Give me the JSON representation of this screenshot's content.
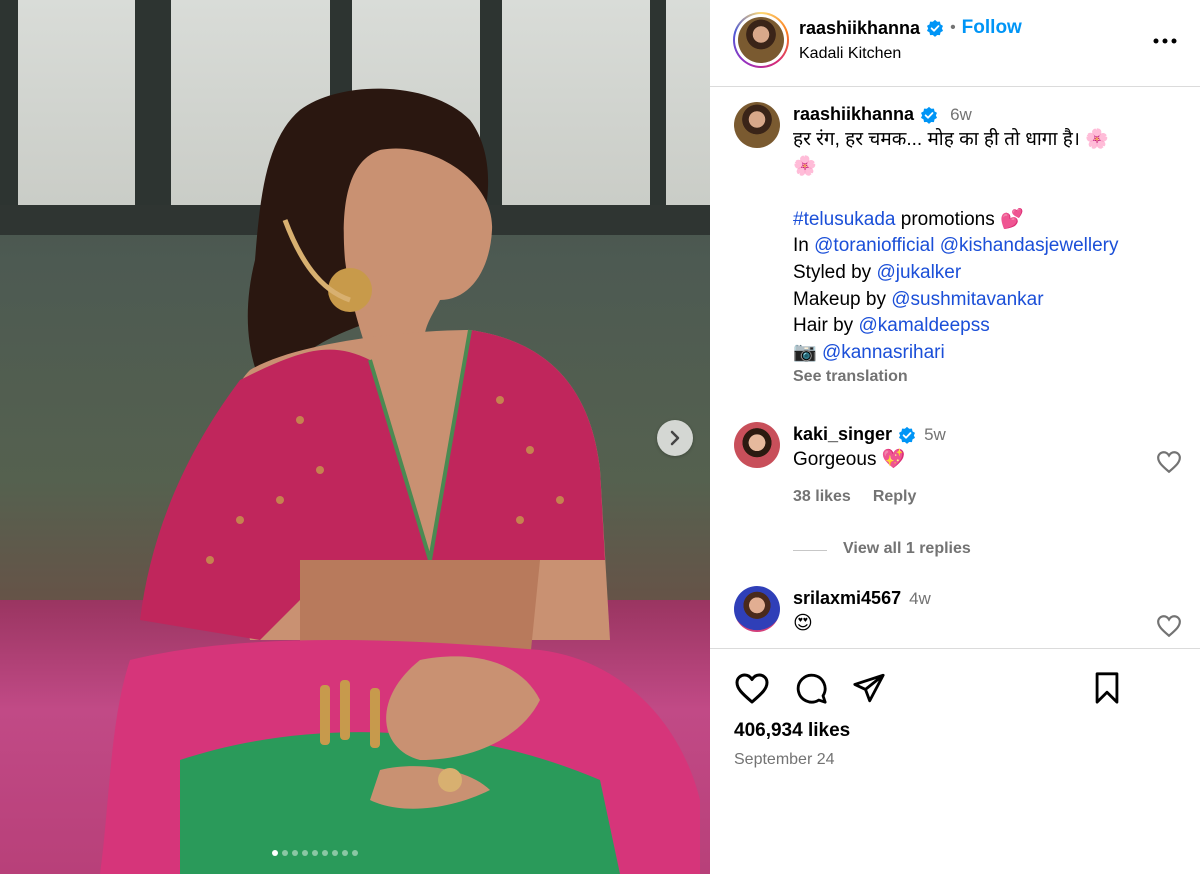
{
  "post": {
    "author": "raashiikhanna",
    "follow_label": "Follow",
    "location": "Kadali Kitchen",
    "more_icon": "more-horizontal-icon",
    "likes": "406,934 likes",
    "date": "September 24",
    "carousel": {
      "total_slides": 9,
      "active_slide": 1
    }
  },
  "caption": {
    "author": "raashiikhanna",
    "time": "6w",
    "line1": "हर रंग, हर चमक... मोह का ही तो धागा है। 🌸",
    "line1b": "🌸",
    "hashtag": "#telusukada",
    "promo_text": " promotions 💕",
    "in_label": "In ",
    "in_tag1": "@toraniofficial",
    "in_tag2": "@kishandasjewellery",
    "styled_label": "Styled by ",
    "styled_tag": "@jukalker",
    "makeup_label": "Makeup by ",
    "makeup_tag": "@sushmitavankar",
    "hair_label": "Hair by ",
    "hair_tag": "@kamaldeepss",
    "camera_label": "📷 ",
    "camera_tag": "@kannasrihari",
    "see_translation": "See translation"
  },
  "comments": [
    {
      "user": "kaki_singer",
      "time": "5w",
      "text": "Gorgeous 💖",
      "likes": "38 likes",
      "reply": "Reply",
      "view_replies": "View all 1 replies"
    },
    {
      "user": "srilaxmi4567",
      "time": "4w",
      "text": "😍"
    }
  ],
  "colors": {
    "accent": "#0095f6",
    "link": "#1b4fd8",
    "verified": "#0095f6",
    "muted": "#737373"
  }
}
